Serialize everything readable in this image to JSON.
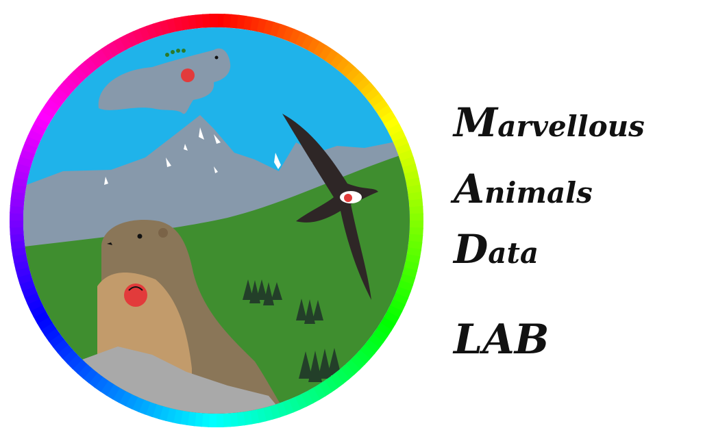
{
  "logo": {
    "ring_colors": [
      "#ff0000",
      "#ffff00",
      "#00ff00",
      "#00ffff",
      "#0000ff",
      "#ff00ff",
      "#ff0000"
    ],
    "sky_color": "#1fb3ea",
    "mountain_color": "#8799ab",
    "meadow_color": "#3f8e2f",
    "rock_color": "#a9a9a9",
    "icons": [
      "seal",
      "swift-bird",
      "marmot",
      "fir-trees",
      "mountain",
      "tag-badge"
    ]
  },
  "title": {
    "line1": {
      "initial": "M",
      "rest": "arvellous"
    },
    "line2": {
      "initial": "A",
      "rest": "nimals"
    },
    "line3": {
      "initial": "D",
      "rest": "ata"
    },
    "line4": "LAB"
  }
}
